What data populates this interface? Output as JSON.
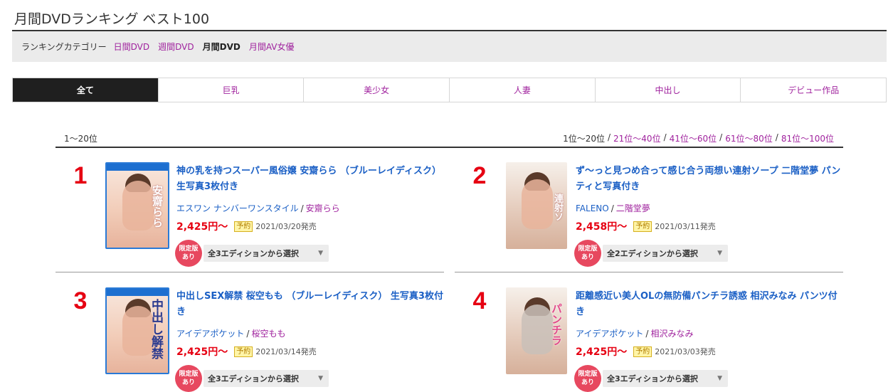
{
  "page": {
    "title": "月間DVDランキング ベスト100"
  },
  "category_bar": {
    "label": "ランキングカテゴリー",
    "items": [
      {
        "label": "日間DVD",
        "active": false
      },
      {
        "label": "週間DVD",
        "active": false
      },
      {
        "label": "月間DVD",
        "active": true
      },
      {
        "label": "月間AV女優",
        "active": false
      }
    ]
  },
  "tabs": [
    {
      "label": "全て",
      "active": true
    },
    {
      "label": "巨乳",
      "active": false
    },
    {
      "label": "美少女",
      "active": false
    },
    {
      "label": "人妻",
      "active": false
    },
    {
      "label": "中出し",
      "active": false
    },
    {
      "label": "デビュー作品",
      "active": false
    }
  ],
  "listing": {
    "range_label": "1〜20位",
    "pager": [
      {
        "label": "1位〜20位",
        "current": true
      },
      {
        "label": "21位〜40位",
        "current": false
      },
      {
        "label": "41位〜60位",
        "current": false
      },
      {
        "label": "61位〜80位",
        "current": false
      },
      {
        "label": "81位〜100位",
        "current": false
      }
    ],
    "separator": "/"
  },
  "products": [
    {
      "rank": "1",
      "title": "神の乳を持つスーパー風俗嬢 安齋らら （ブルーレイディスク） 生写真3枚付き",
      "maker": "エスワン ナンバーワンスタイル",
      "actress": "安齋らら",
      "price": "2,425円〜",
      "reserve": "予約",
      "release": "2021/03/20発売",
      "limited": [
        "限定版",
        "あり"
      ],
      "edition_select": "全3エディションから選択",
      "cover_text": "安齋らら",
      "cover_style": "bluray"
    },
    {
      "rank": "2",
      "title": "ず〜っと見つめ合って感じ合う両想い連射ソープ 二階堂夢 パンティと写真付き",
      "maker": "FALENO",
      "actress": "二階堂夢",
      "price": "2,458円〜",
      "reserve": "予約",
      "release": "2021/03/11発売",
      "limited": [
        "限定版",
        "あり"
      ],
      "edition_select": "全2エディションから選択",
      "cover_text": "連射ソ",
      "cover_style": "dvd"
    },
    {
      "rank": "3",
      "title": "中出しSEX解禁 桜空もも （ブルーレイディスク） 生写真3枚付き",
      "maker": "アイデアポケット",
      "actress": "桜空もも",
      "price": "2,425円〜",
      "reserve": "予約",
      "release": "2021/03/14発売",
      "limited": [
        "限定版",
        "あり"
      ],
      "edition_select": "全3エディションから選択",
      "cover_text": "中出し解禁",
      "cover_style": "bluray"
    },
    {
      "rank": "4",
      "title": "距離感近い美人OLの無防備パンチラ誘惑 相沢みなみ パンツ付き",
      "maker": "アイデアポケット",
      "actress": "相沢みなみ",
      "price": "2,425円〜",
      "reserve": "予約",
      "release": "2021/03/03発売",
      "limited": [
        "限定版",
        "あり"
      ],
      "edition_select": "全3エディションから選択",
      "cover_text": "パンチラ",
      "cover_style": "dvd"
    }
  ],
  "colors": {
    "link_blue": "#1a5fc5",
    "link_purple": "#a0239e",
    "rank_red": "#e60012",
    "badge_pink": "#e7485f"
  }
}
